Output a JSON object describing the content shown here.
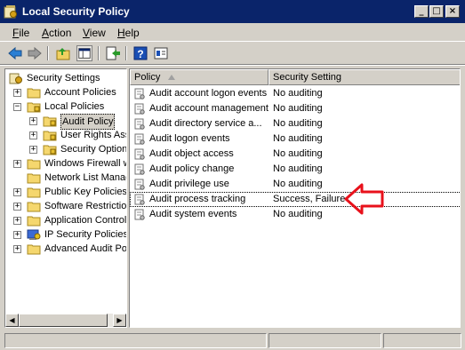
{
  "window": {
    "title": "Local Security Policy",
    "controls": {
      "minimize": "_",
      "maximize": "□",
      "close": "×"
    }
  },
  "menubar": {
    "items": [
      {
        "label": "File",
        "accel": "F",
        "rest": "ile"
      },
      {
        "label": "Action",
        "accel": "A",
        "rest": "ction"
      },
      {
        "label": "View",
        "accel": "V",
        "rest": "iew"
      },
      {
        "label": "Help",
        "accel": "H",
        "rest": "elp"
      }
    ]
  },
  "toolbar": {
    "buttons": [
      "back-icon",
      "forward-icon",
      "up-folder-icon",
      "show-hide-tree-icon",
      "export-list-icon",
      "help-icon",
      "properties-icon"
    ]
  },
  "tree": {
    "root": "Security Settings",
    "items": [
      {
        "label": "Account Policies",
        "expander": "+",
        "icon": "folder-icon"
      },
      {
        "label": "Local Policies",
        "expander": "−",
        "icon": "folder-open-icon"
      },
      {
        "label": "Audit Policy",
        "expander": "+",
        "icon": "folder-icon",
        "selected": true
      },
      {
        "label": "User Rights Assignment",
        "expander": "+",
        "icon": "folder-icon"
      },
      {
        "label": "Security Options",
        "expander": "+",
        "icon": "folder-icon"
      },
      {
        "label": "Windows Firewall with Advanced Security",
        "expander": "+",
        "icon": "folder-icon"
      },
      {
        "label": "Network List Manager Policies",
        "expander": "",
        "icon": "folder-icon"
      },
      {
        "label": "Public Key Policies",
        "expander": "+",
        "icon": "folder-icon"
      },
      {
        "label": "Software Restriction Policies",
        "expander": "+",
        "icon": "folder-icon"
      },
      {
        "label": "Application Control Policies",
        "expander": "+",
        "icon": "folder-icon"
      },
      {
        "label": "IP Security Policies on Local Computer",
        "expander": "+",
        "icon": "ip-security-icon"
      },
      {
        "label": "Advanced Audit Policy Configuration",
        "expander": "+",
        "icon": "folder-icon"
      }
    ]
  },
  "list": {
    "columns": {
      "policy": "Policy",
      "setting": "Security Setting"
    },
    "rows": [
      {
        "policy": "Audit account logon events",
        "setting": "No auditing"
      },
      {
        "policy": "Audit account management",
        "setting": "No auditing"
      },
      {
        "policy": "Audit directory service a...",
        "setting": "No auditing"
      },
      {
        "policy": "Audit logon events",
        "setting": "No auditing"
      },
      {
        "policy": "Audit object access",
        "setting": "No auditing"
      },
      {
        "policy": "Audit policy change",
        "setting": "No auditing"
      },
      {
        "policy": "Audit privilege use",
        "setting": "No auditing"
      },
      {
        "policy": "Audit process tracking",
        "setting": "Success, Failure"
      },
      {
        "policy": "Audit system events",
        "setting": "No auditing"
      }
    ]
  },
  "colors": {
    "titlebar": "#0a246a",
    "face": "#d4d0c8",
    "annotation_arrow": "#e8111b"
  }
}
